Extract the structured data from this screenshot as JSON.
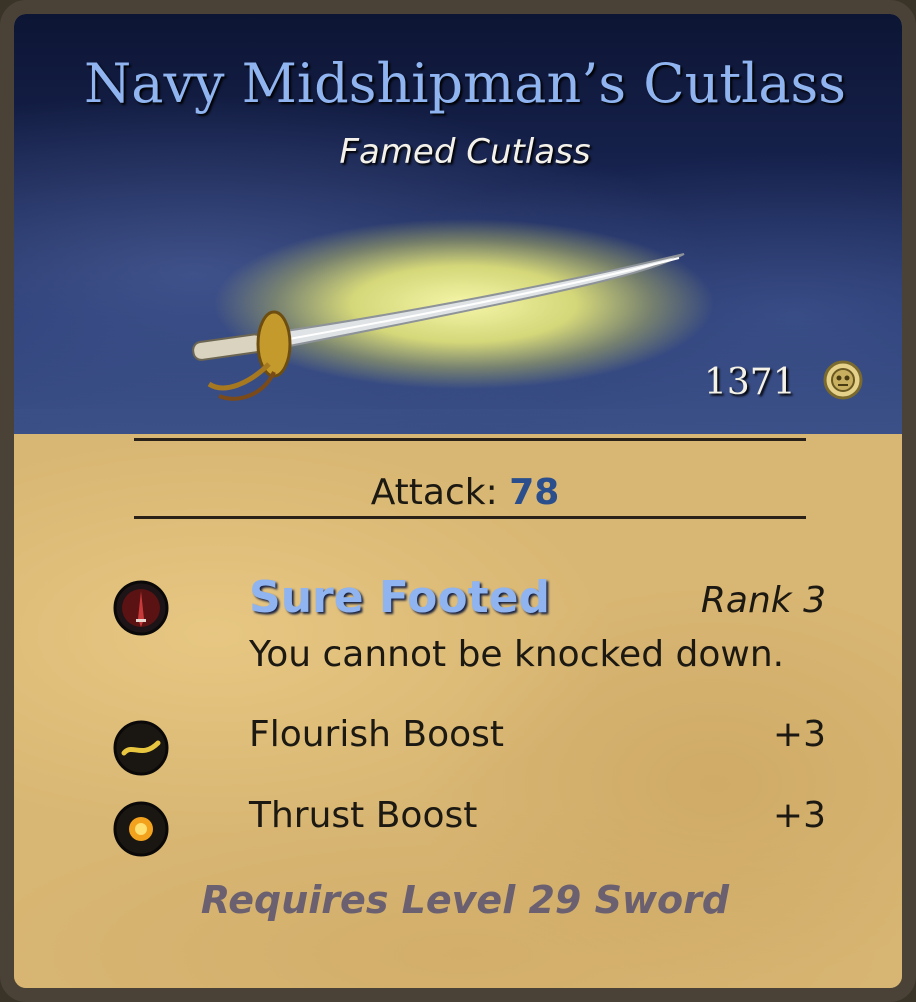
{
  "item": {
    "name": "Navy Midshipman’s Cutlass",
    "type": "Famed Cutlass",
    "price": "1371",
    "currency_icon": "gold-coin-icon"
  },
  "stats": {
    "attack_label": "Attack:",
    "attack_value": "78"
  },
  "ability": {
    "name": "Sure Footed",
    "rank": "Rank 3",
    "description": "You cannot be knocked down.",
    "icon": "sure-footed-icon"
  },
  "boosts": [
    {
      "name": "Flourish Boost",
      "value": "+3",
      "icon": "flourish-icon"
    },
    {
      "name": "Thrust Boost",
      "value": "+3",
      "icon": "thrust-icon"
    }
  ],
  "requirement": "Requires Level 29 Sword",
  "colors": {
    "title": "#8fb4f0",
    "attack_value": "#2b4f8c",
    "parchment": "#d8b673",
    "sky": "#17234f"
  }
}
